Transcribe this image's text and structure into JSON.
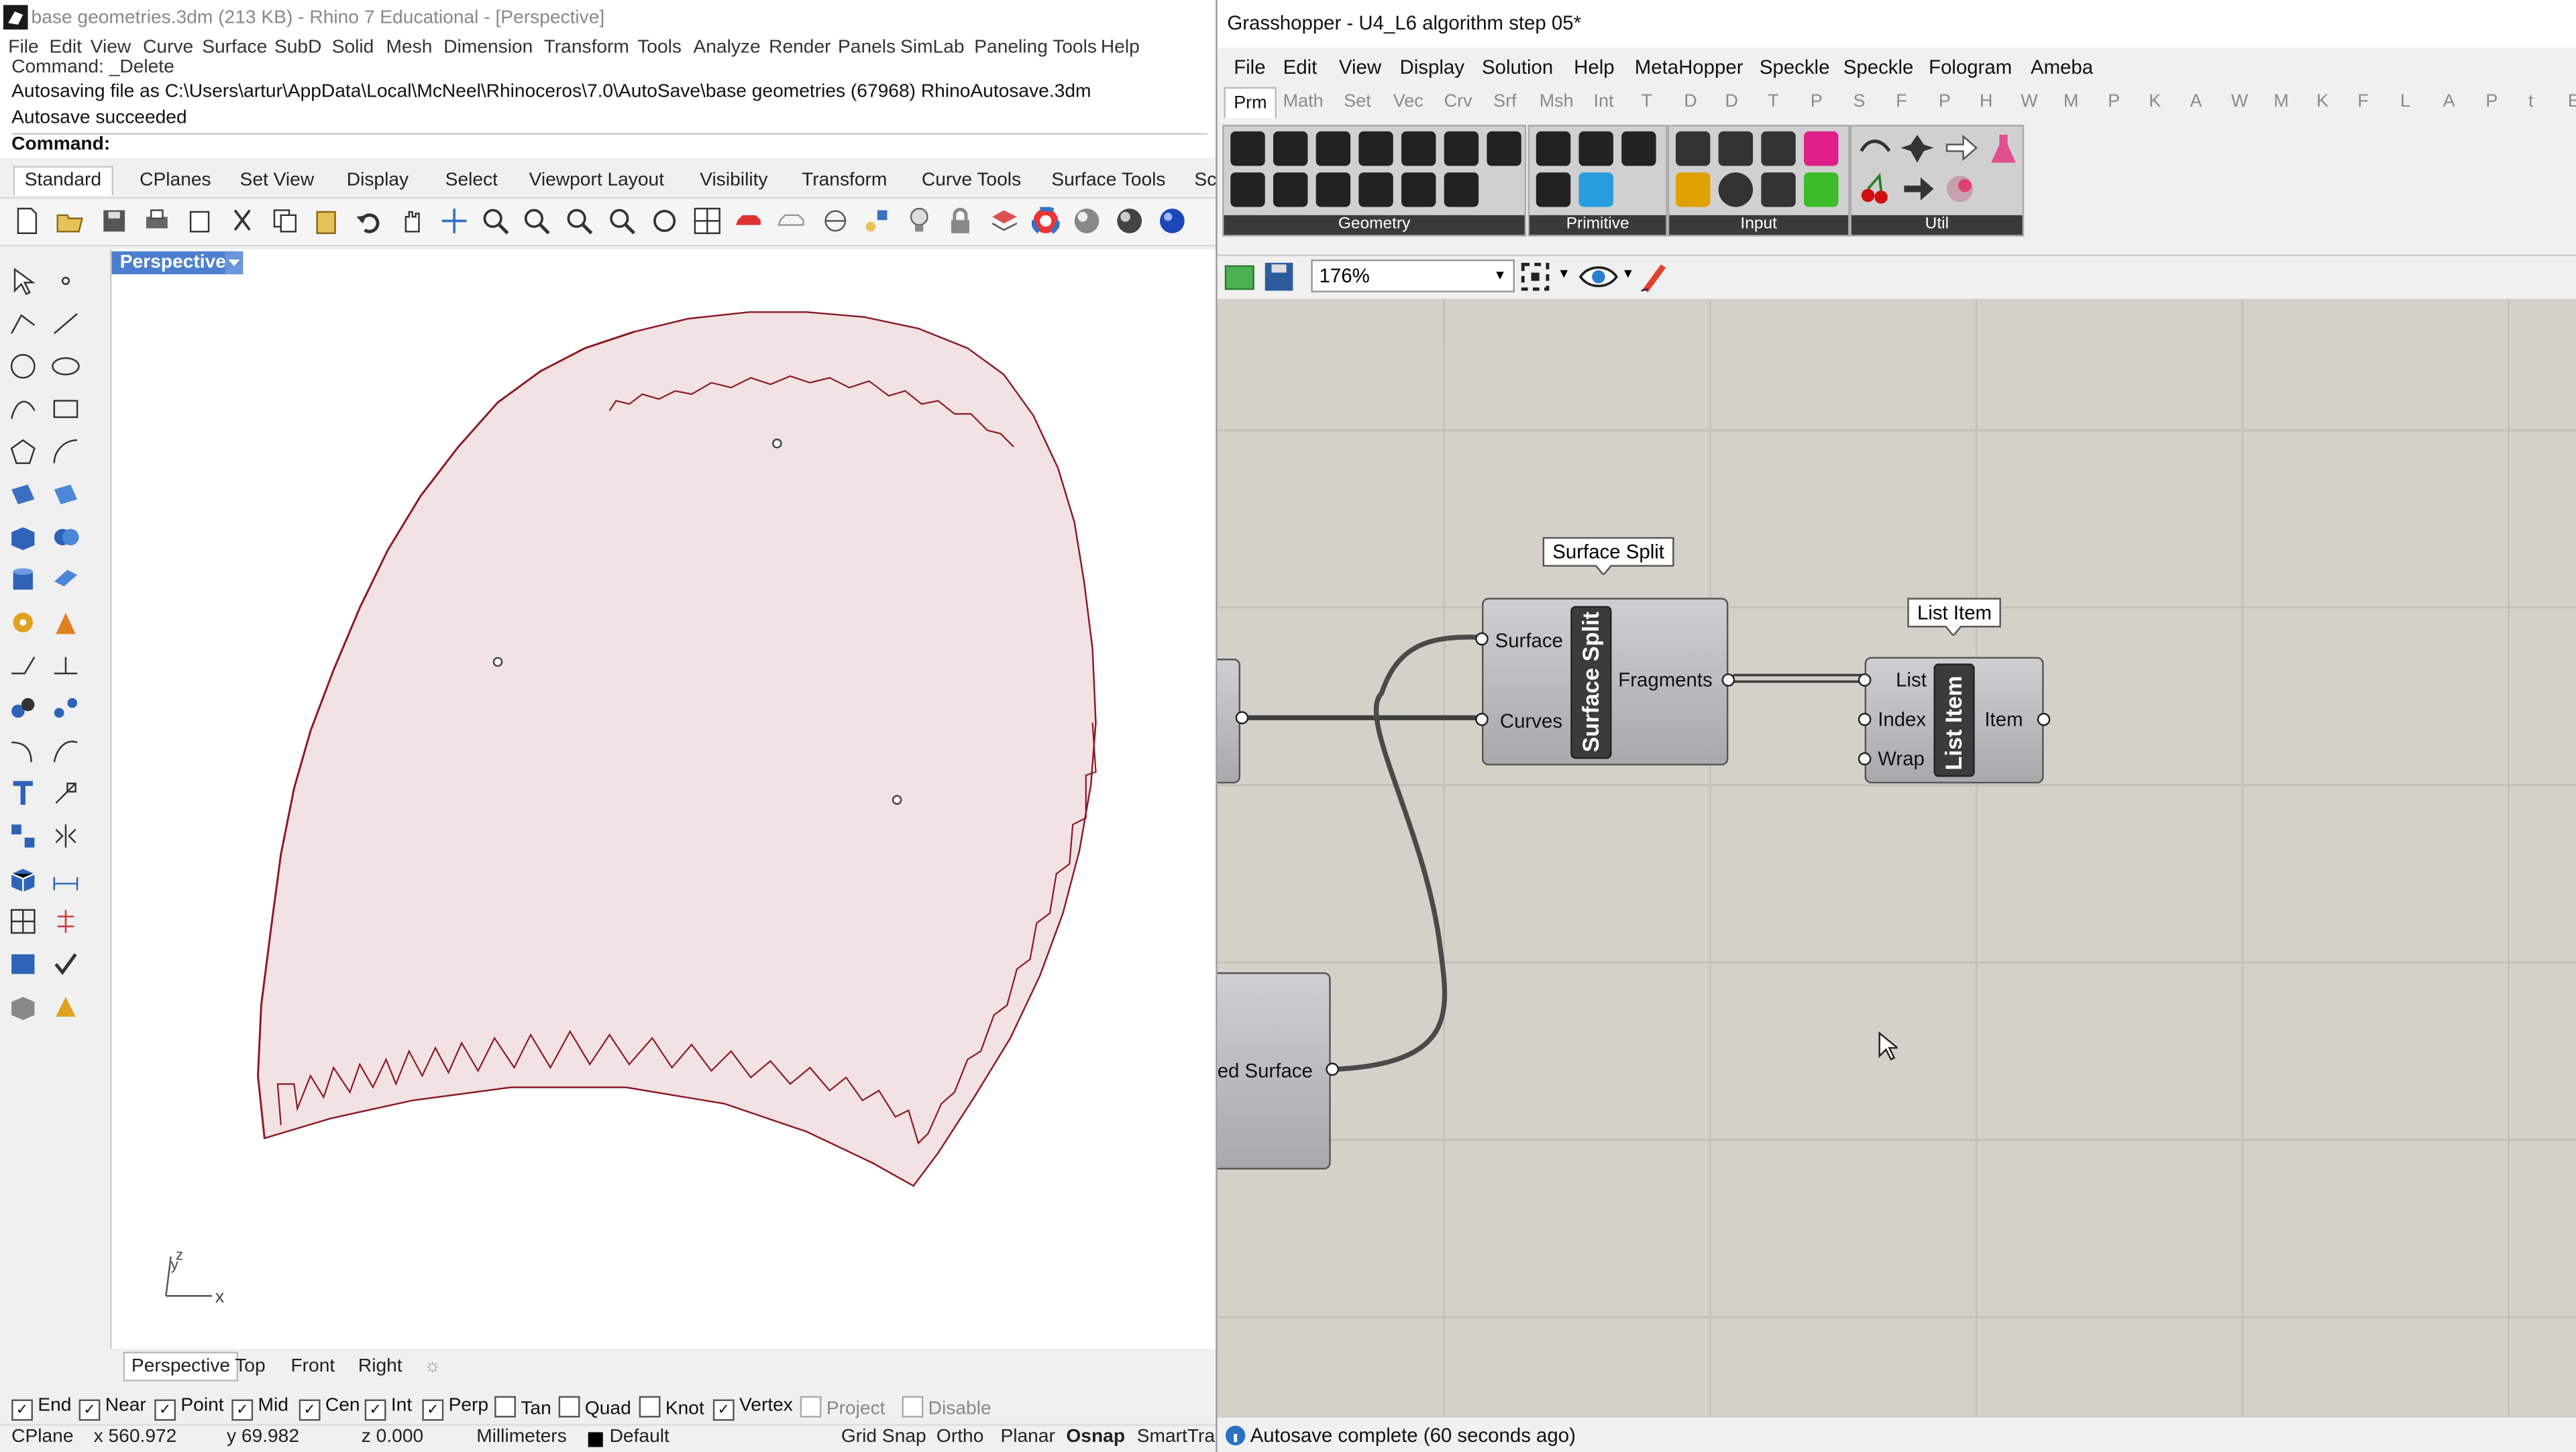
{
  "rhino": {
    "title": "base geometries.3dm (213 KB) - Rhino 7 Educational - [Perspective]",
    "menu": [
      "File",
      "Edit",
      "View",
      "Curve",
      "Surface",
      "SubD",
      "Solid",
      "Mesh",
      "Dimension",
      "Transform",
      "Tools",
      "Analyze",
      "Render",
      "Panels",
      "SimLab",
      "Paneling Tools",
      "Help"
    ],
    "command_history": [
      "Command: _Delete",
      "Autosaving file as C:\\Users\\artur\\AppData\\Local\\McNeel\\Rhinoceros\\7.0\\AutoSave\\base geometries (67968) RhinoAutosave.3dm",
      "Autosave succeeded"
    ],
    "command_prompt": "Command:",
    "toolbar_tabs": [
      "Standard",
      "CPlanes",
      "Set View",
      "Display",
      "Select",
      "Viewport Layout",
      "Visibility",
      "Transform",
      "Curve Tools",
      "Surface Tools",
      "Sc"
    ],
    "viewport_title": "Perspective",
    "viewport_tabs": [
      "Perspective",
      "Top",
      "Front",
      "Right"
    ],
    "axis_labels": {
      "x": "x",
      "y": "y",
      "z": "z"
    },
    "osnaps": [
      {
        "label": "End",
        "checked": true
      },
      {
        "label": "Near",
        "checked": true
      },
      {
        "label": "Point",
        "checked": true
      },
      {
        "label": "Mid",
        "checked": true
      },
      {
        "label": "Cen",
        "checked": true
      },
      {
        "label": "Int",
        "checked": true
      },
      {
        "label": "Perp",
        "checked": true
      },
      {
        "label": "Tan",
        "checked": false
      },
      {
        "label": "Quad",
        "checked": false
      },
      {
        "label": "Knot",
        "checked": false
      },
      {
        "label": "Vertex",
        "checked": true
      },
      {
        "label": "Project",
        "checked": false,
        "disabled": true
      },
      {
        "label": "Disable",
        "checked": false,
        "disabled": true
      }
    ],
    "status": {
      "cplane": "CPlane",
      "x": "x 560.972",
      "y": "y 69.982",
      "z": "z 0.000",
      "units": "Millimeters",
      "layer": "Default",
      "grid_snap": "Grid Snap",
      "ortho": "Ortho",
      "planar": "Planar",
      "osnap": "Osnap",
      "smarttrack": "SmartTrac"
    }
  },
  "grasshopper": {
    "title": "Grasshopper - U4_L6 algorithm step 05*",
    "menu": [
      "File",
      "Edit",
      "View",
      "Display",
      "Solution",
      "Help",
      "MetaHopper",
      "Speckle",
      "Speckle",
      "Fologram",
      "Ameba"
    ],
    "tabs": [
      "Prm",
      "Math",
      "Set",
      "Vec",
      "Crv",
      "Srf",
      "Msh",
      "Int",
      "T",
      "D",
      "D",
      "T",
      "P",
      "S",
      "F",
      "P",
      "H",
      "W",
      "M",
      "P",
      "K",
      "A",
      "W",
      "M",
      "K",
      "F",
      "L",
      "A",
      "P",
      "t",
      "E"
    ],
    "groups": [
      "Geometry",
      "Primitive",
      "Input",
      "Util"
    ],
    "zoom": "176%",
    "components": {
      "surface_split": {
        "tooltip": "Surface Split",
        "name": "Surface Split",
        "inputs": [
          "Surface",
          "Curves"
        ],
        "outputs": [
          "Fragments"
        ]
      },
      "list_item": {
        "tooltip": "List Item",
        "name": "List Item",
        "inputs": [
          "List",
          "Index",
          "Wrap"
        ],
        "outputs": [
          "Item"
        ]
      },
      "partial": {
        "label": "ed Surface"
      }
    },
    "status": "Autosave complete (60 seconds ago)",
    "colors": {
      "canvas": "#d4d1c9",
      "speckle": "#d2232a",
      "wire": "#4a4a4a"
    }
  }
}
